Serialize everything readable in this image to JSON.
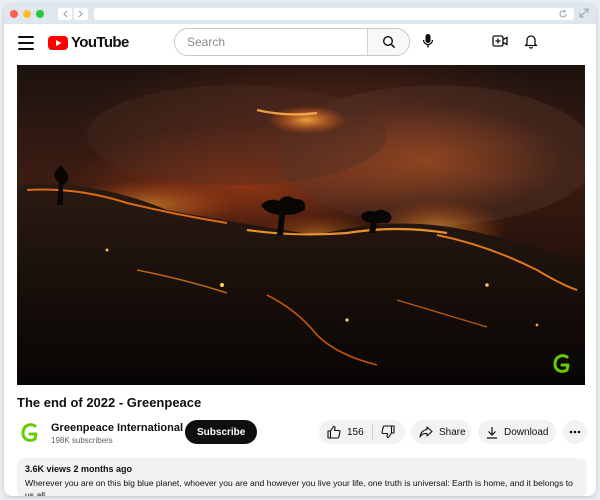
{
  "header": {
    "logo_text": "YouTube",
    "search_placeholder": "Search"
  },
  "video": {
    "title": "The end of 2022 - Greenpeace"
  },
  "channel": {
    "name": "Greenpeace International",
    "subscribers": "198K subscribers",
    "subscribe_label": "Subscribe"
  },
  "actions": {
    "like_count": "156",
    "share_label": "Share",
    "download_label": "Download"
  },
  "description": {
    "meta": "3.6K views  2 months ago",
    "text": "Wherever you are on this big blue planet, whoever you are and however you live your life, one truth is universal: Earth is home, and it belongs to us all."
  },
  "colors": {
    "brand_red": "#ff0000",
    "greenpeace_green": "#66cc00"
  }
}
